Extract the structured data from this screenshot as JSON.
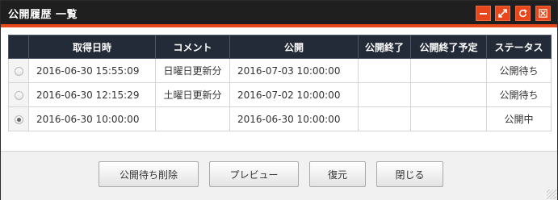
{
  "dialog": {
    "title": "公開履歴 一覧",
    "controls": {
      "minimize_icon": "minimize-icon",
      "maximize_icon": "maximize-icon",
      "refresh_icon": "refresh-icon",
      "close_icon": "close-icon"
    },
    "accent_color": "#e8471b"
  },
  "table": {
    "columns": [
      "",
      "取得日時",
      "コメント",
      "公開",
      "公開終了",
      "公開終了予定",
      "ステータス"
    ],
    "rows": [
      {
        "selected": false,
        "date": "2016-06-30 15:55:09",
        "comment": "日曜日更新分",
        "publish": "2016-07-03 10:00:00",
        "publish_end": "",
        "publish_end_planned": "",
        "status": "公開待ち"
      },
      {
        "selected": false,
        "date": "2016-06-30 12:15:29",
        "comment": "土曜日更新分",
        "publish": "2016-07-02 10:00:00",
        "publish_end": "",
        "publish_end_planned": "",
        "status": "公開待ち"
      },
      {
        "selected": true,
        "date": "2016-06-30 10:00:00",
        "comment": "",
        "publish": "2016-06-30 10:00:00",
        "publish_end": "",
        "publish_end_planned": "",
        "status": "公開中"
      }
    ]
  },
  "footer": {
    "delete_pending_label": "公開待ち削除",
    "preview_label": "プレビュー",
    "restore_label": "復元",
    "close_label": "閉じる"
  }
}
